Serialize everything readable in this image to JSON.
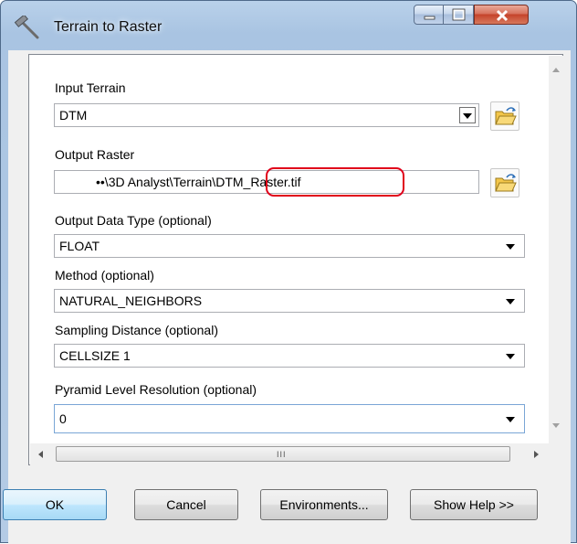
{
  "window": {
    "title": "Terrain to Raster",
    "title_icon": "hammer-icon",
    "controls": [
      "minimize-icon",
      "maximize-icon",
      "close-icon"
    ]
  },
  "form": {
    "input_terrain": {
      "label": "Input Terrain",
      "value": "DTM",
      "icon": "folder-open-icon"
    },
    "output_raster": {
      "label": "Output Raster",
      "value_path": "••\\3D Analyst\\Terrain\\",
      "value_file": "DTM_Raster.tif",
      "icon": "folder-open-icon",
      "highlight_color": "#e0001a"
    },
    "output_data_type": {
      "label": "Output Data Type (optional)",
      "value": "FLOAT"
    },
    "method": {
      "label": "Method (optional)",
      "value": "NATURAL_NEIGHBORS"
    },
    "sampling_distance": {
      "label": "Sampling Distance (optional)",
      "value": "CELLSIZE 1"
    },
    "pyramid_level": {
      "label": "Pyramid Level Resolution (optional)",
      "value": "0"
    }
  },
  "scrollbar": {
    "grip": "III"
  },
  "buttons": {
    "ok": "OK",
    "cancel": "Cancel",
    "environments": "Environments...",
    "show_help": "Show Help >>"
  },
  "colors": {
    "titlebar": "#b9d1ea",
    "close_button": "#c5432a",
    "ok_button": "#bee6fd",
    "highlight": "#e0001a"
  }
}
